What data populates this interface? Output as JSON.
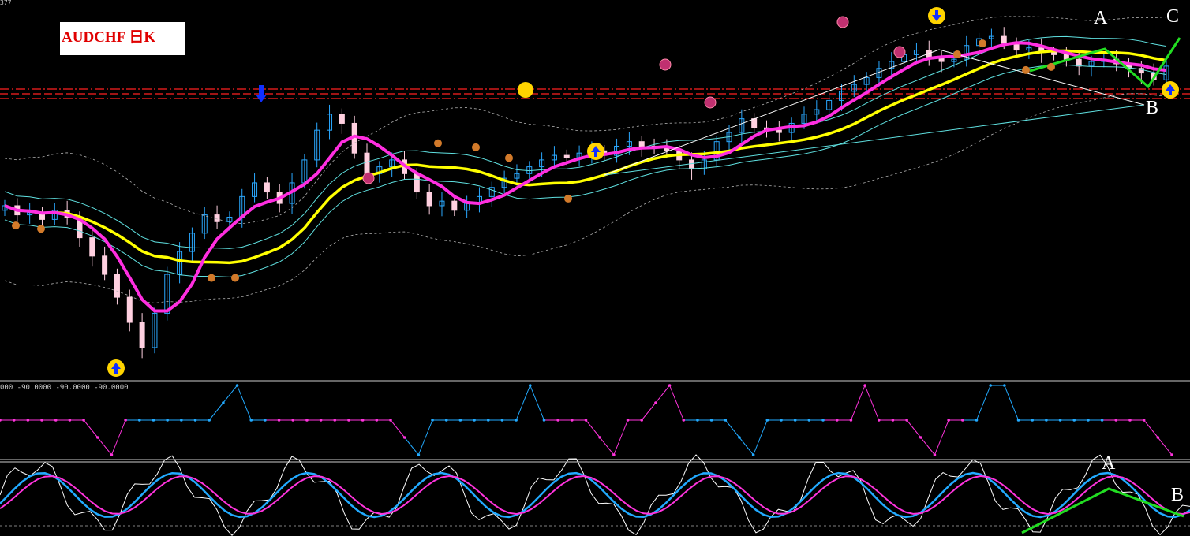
{
  "title": "AUDCHF 日K",
  "top_value": "377",
  "indicator_label": "000 -90.0000 -90.0000 -90.0000",
  "labels": {
    "A": "A",
    "B": "B",
    "C": "C",
    "A2": "A",
    "B2": "B"
  },
  "colors": {
    "background": "#000000",
    "ma_fast": "#ff2ee0",
    "ma_slow": "#ffff00",
    "band": "#5fe0e0",
    "outer_band": "#b0b0b0",
    "bull_candle": "#2aa8ff",
    "bear_candle": "#ffd0e0",
    "resistance": "#ff2020",
    "green_pattern": "#22dd22",
    "stoch_main": "#ffffff",
    "stoch_k": "#22aaff",
    "stoch_d": "#ff33dd"
  },
  "chart_data": [
    {
      "type": "candlestick",
      "title": "AUDCHF 日K",
      "series_main_close": [
        0.702,
        0.698,
        0.699,
        0.696,
        0.7,
        0.697,
        0.688,
        0.68,
        0.672,
        0.662,
        0.651,
        0.64,
        0.655,
        0.672,
        0.682,
        0.69,
        0.698,
        0.695,
        0.697,
        0.706,
        0.712,
        0.708,
        0.703,
        0.712,
        0.722,
        0.735,
        0.742,
        0.738,
        0.725,
        0.716,
        0.719,
        0.722,
        0.716,
        0.708,
        0.702,
        0.704,
        0.7,
        0.703,
        0.706,
        0.71,
        0.714,
        0.716,
        0.719,
        0.722,
        0.724,
        0.723,
        0.725,
        0.726,
        0.724,
        0.728,
        0.73,
        0.728,
        0.727,
        0.726,
        0.722,
        0.718,
        0.722,
        0.73,
        0.734,
        0.74,
        0.736,
        0.735,
        0.734,
        0.738,
        0.742,
        0.744,
        0.748,
        0.752,
        0.755,
        0.758,
        0.762,
        0.765,
        0.768,
        0.77,
        0.767,
        0.765,
        0.766,
        0.772,
        0.775,
        0.776,
        0.773,
        0.77,
        0.771,
        0.769,
        0.768,
        0.766,
        0.763,
        0.765,
        0.766,
        0.764,
        0.762,
        0.76,
        0.757,
        0.763
      ],
      "resistance_levels": [
        0.7414,
        0.7398,
        0.7385
      ],
      "annotations": [
        "A",
        "B",
        "C"
      ]
    },
    {
      "type": "line",
      "series": [
        {
          "values": [
            -90,
            -90,
            -90,
            -90,
            -90,
            -90,
            -90,
            -92,
            -94,
            -90,
            -90,
            -90,
            -90,
            -90,
            -90,
            -90,
            -88,
            -86,
            -90,
            -90,
            -90,
            -90,
            -90,
            -90,
            -90,
            -90,
            -90,
            -90,
            -90,
            -92,
            -94,
            -90,
            -90,
            -90,
            -90,
            -90,
            -90,
            -90,
            -86,
            -90,
            -90,
            -90,
            -90,
            -92,
            -94,
            -90,
            -90,
            -88,
            -86,
            -90,
            -90,
            -90,
            -90,
            -92,
            -94,
            -90,
            -90,
            -90,
            -90,
            -90,
            -90,
            -90,
            -86,
            -90,
            -90,
            -90,
            -92,
            -94,
            -90,
            -90,
            -90,
            -86,
            -86,
            -90,
            -90,
            -90,
            -90,
            -90,
            -90,
            -90,
            -90,
            -90,
            -90,
            -92,
            -94
          ]
        }
      ]
    },
    {
      "type": "line",
      "annotations": [
        "A",
        "B"
      ]
    }
  ]
}
